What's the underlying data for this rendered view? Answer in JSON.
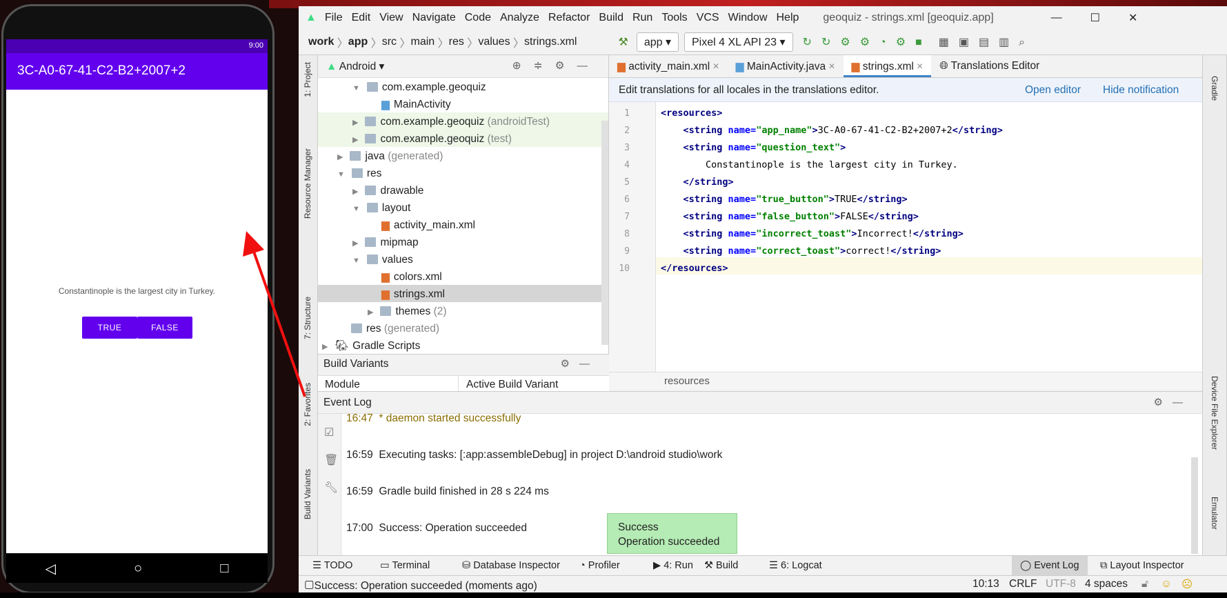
{
  "phone": {
    "status_time": "9:00",
    "app_title": "3C-A0-67-41-C2-B2+2007+2",
    "question": "Constantinople is the largest city in Turkey.",
    "true_button": "TRUE",
    "false_button": "FALSE",
    "colors": {
      "primary": "#6200ee"
    }
  },
  "ide": {
    "window_title": "geoquiz - strings.xml [geoquiz.app]",
    "menu": [
      "File",
      "Edit",
      "View",
      "Navigate",
      "Code",
      "Analyze",
      "Refactor",
      "Build",
      "Run",
      "Tools",
      "VCS",
      "Window",
      "Help"
    ],
    "breadcrumb": [
      "work",
      "app",
      "src",
      "main",
      "res",
      "values",
      "strings.xml"
    ],
    "run_config": "app",
    "device": "Pixel 4 XL API 23",
    "left_tools": [
      "1: Project",
      "Resource Manager",
      "7: Structure",
      "2: Favorites",
      "Build Variants"
    ],
    "right_tools": [
      "Gradle",
      "Device File Explorer",
      "Emulator"
    ],
    "project_view": "Android",
    "tree": [
      {
        "label": "com.example.geoquiz",
        "suffix": ""
      },
      {
        "label": "MainActivity",
        "suffix": ""
      },
      {
        "label": "com.example.geoquiz",
        "suffix": "(androidTest)"
      },
      {
        "label": "com.example.geoquiz",
        "suffix": "(test)"
      },
      {
        "label": "java",
        "suffix": "(generated)"
      },
      {
        "label": "res",
        "suffix": ""
      },
      {
        "label": "drawable",
        "suffix": ""
      },
      {
        "label": "layout",
        "suffix": ""
      },
      {
        "label": "activity_main.xml",
        "suffix": ""
      },
      {
        "label": "mipmap",
        "suffix": ""
      },
      {
        "label": "values",
        "suffix": ""
      },
      {
        "label": "colors.xml",
        "suffix": ""
      },
      {
        "label": "strings.xml",
        "suffix": ""
      },
      {
        "label": "themes",
        "suffix": "(2)"
      },
      {
        "label": "res",
        "suffix": "(generated)"
      },
      {
        "label": "Gradle Scripts",
        "suffix": ""
      }
    ],
    "tabs": [
      "activity_main.xml",
      "MainActivity.java",
      "strings.xml",
      "Translations Editor"
    ],
    "notification": {
      "text": "Edit translations for all locales in the translations editor.",
      "open": "Open editor",
      "hide": "Hide notification"
    },
    "code_breadcrumb": "resources",
    "build_variants": {
      "title": "Build Variants",
      "col1": "Module",
      "col2": "Active Build Variant"
    },
    "event_log": {
      "title": "Event Log",
      "entries": [
        {
          "time": "16:47",
          "text": "* daemon started successfully"
        },
        {
          "time": "16:59",
          "text": "Executing tasks: [:app:assembleDebug] in project D:\\android studio\\work"
        },
        {
          "time": "16:59",
          "text": "Gradle build finished in 28 s 224 ms"
        },
        {
          "time": "17:00",
          "text": "Success: Operation succeeded"
        }
      ]
    },
    "toast": {
      "title": "Success",
      "text": "Operation succeeded"
    },
    "bottom_tools": [
      "TODO",
      "Terminal",
      "Database Inspector",
      "Profiler",
      "4: Run",
      "Build",
      "6: Logcat",
      "Event Log",
      "Layout Inspector"
    ],
    "status": {
      "message": "Success: Operation succeeded (moments ago)",
      "position": "10:13",
      "line_sep": "CRLF",
      "encoding": "UTF-8",
      "indent": "4 spaces"
    }
  }
}
